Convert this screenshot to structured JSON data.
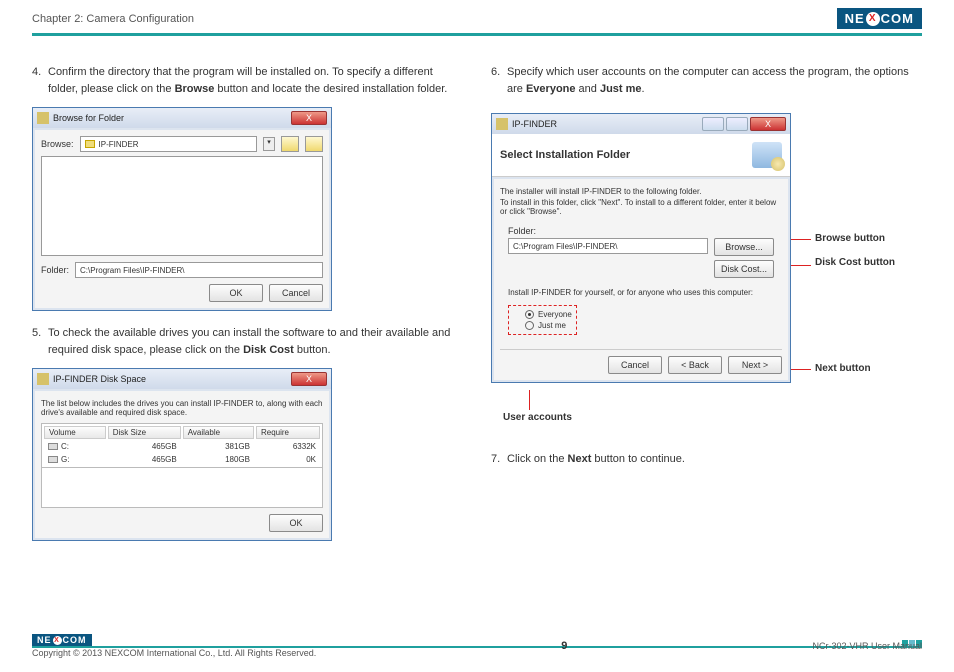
{
  "header": {
    "chapter": "Chapter 2: Camera Configuration",
    "logo_left": "NE",
    "logo_x": "X",
    "logo_right": "COM"
  },
  "left": {
    "step4": {
      "num": "4.",
      "text_a": "Confirm the directory that the program will be installed on. To specify a different folder, please click on the ",
      "bold": "Browse",
      "text_b": " button and locate the desired installation folder."
    },
    "dlg1": {
      "title": "Browse for Folder",
      "browse_lbl": "Browse:",
      "combo_text": "IP-FINDER",
      "folder_lbl": "Folder:",
      "folder_val": "C:\\Program Files\\IP-FINDER\\",
      "ok": "OK",
      "cancel": "Cancel",
      "close": "X"
    },
    "step5": {
      "num": "5.",
      "text_a": "To check the available drives you can install the software to and their available and required disk space, please click on the ",
      "bold": "Disk Cost",
      "text_b": " button."
    },
    "dlg2": {
      "title": "IP-FINDER Disk Space",
      "desc": "The list below includes the drives you can install IP-FINDER to, along with each drive's available and required disk space.",
      "cols": {
        "c1": "Volume",
        "c2": "Disk Size",
        "c3": "Available",
        "c4": "Require"
      },
      "rows": [
        {
          "v": "C:",
          "s": "465GB",
          "a": "381GB",
          "r": "6332K"
        },
        {
          "v": "G:",
          "s": "465GB",
          "a": "180GB",
          "r": "0K"
        }
      ],
      "ok": "OK",
      "close": "X"
    }
  },
  "right": {
    "step6": {
      "num": "6.",
      "text_a": "Specify which user accounts on the computer can access the program, the options are ",
      "bold1": "Everyone",
      "mid": " and ",
      "bold2": "Just me",
      "end": "."
    },
    "dlg3": {
      "title": "IP-FINDER",
      "heading": "Select Installation Folder",
      "line1": "The installer will install IP-FINDER to the following folder.",
      "line2": "To install in this folder, click \"Next\". To install to a different folder, enter it below or click \"Browse\".",
      "folder_lbl": "Folder:",
      "folder_val": "C:\\Program Files\\IP-FINDER\\",
      "browse_btn": "Browse...",
      "diskcost_btn": "Disk Cost...",
      "install_for": "Install IP-FINDER for yourself, or for anyone who uses this computer:",
      "opt1": "Everyone",
      "opt2": "Just me",
      "cancel": "Cancel",
      "back": "< Back",
      "next": "Next >",
      "close": "X"
    },
    "callouts": {
      "browse": "Browse button",
      "diskcost": "Disk Cost button",
      "next": "Next button",
      "user": "User accounts"
    },
    "step7": {
      "num": "7.",
      "text_a": "Click on the ",
      "bold": "Next",
      "text_b": " button to continue."
    }
  },
  "footer": {
    "copyright": "Copyright © 2013 NEXCOM International Co., Ltd. All Rights Reserved.",
    "page": "9",
    "manual": "NCr-302-VHR User Manual"
  }
}
